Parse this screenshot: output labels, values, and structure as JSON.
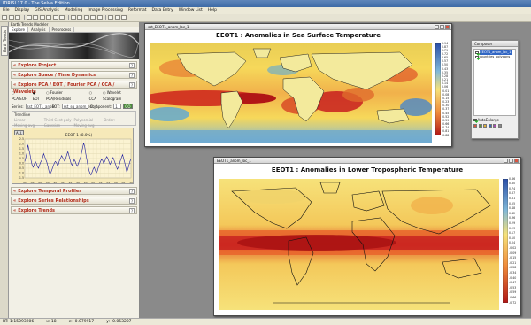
{
  "app": {
    "title": "IDRISI 17.0 · The Selva Edition"
  },
  "menu": [
    "File",
    "Display",
    "GIS Analysis",
    "Modeling",
    "Image Processing",
    "Reformat",
    "Data Entry",
    "Window List",
    "Help"
  ],
  "status": {
    "items": [
      "RT: 1:15093206",
      "x:  18",
      "c:  -0.079917",
      "y:  -0.053207"
    ]
  },
  "side_tab": {
    "label": "Earth Trends Modeler"
  },
  "panel": {
    "title": "Earth Trends Modeler",
    "tabs": [
      "Explore",
      "Analysis",
      "Preprocess"
    ],
    "sections": {
      "project": "Explore Project",
      "space_time": "Explore Space / Time Dynamics",
      "pca": "Explore PCA / EOT / Fourier PCA / CCA / Wavelets",
      "profiles": "Explore Temporal Profiles",
      "relationships": "Explore Series Relationships",
      "trends": "Explore Trends"
    },
    "help_glyph": "?",
    "chevron": "«",
    "pca_options": [
      "PCA/EOF",
      "EOT",
      "Fourier PCA/Residuals",
      "CCA",
      "Wavelet Scalogram"
    ],
    "series_label": "Series:",
    "series_value": "sst_EOT1_anom",
    "eot_label": "EOT:",
    "eot_value": "sst_sg_anom_eot_1",
    "component_label": "Component:",
    "component_value": "1",
    "go_button": "GO",
    "trend_group": "Trendline",
    "trend_options": [
      "Linear",
      "Third-Cent poly",
      "Polynomial",
      "Moving avg",
      "Gaussian moving avg",
      "Moving avg"
    ],
    "order_label": "Order:",
    "chart_toolbar": "ALL",
    "chart_title": "EEOT 1 (8.0%)"
  },
  "chart_data": {
    "type": "line",
    "title": "EEOT 1 (8.0%)",
    "xlabel": "",
    "ylabel": "",
    "x_tick_labels": [
      "82",
      "83",
      "84",
      "85",
      "86",
      "87",
      "88",
      "89",
      "90",
      "91",
      "92",
      "93",
      "94",
      "95",
      "96",
      "97",
      "98",
      "99",
      "00",
      "01",
      "02",
      "03",
      "04",
      "05",
      "06",
      "07",
      "08",
      "09",
      "10"
    ],
    "y_tick_labels": [
      "2.5",
      "2.0",
      "1.5",
      "1.0",
      "0.5",
      "0.0",
      "-0.5",
      "-1.0",
      "-1.5"
    ],
    "ylim": [
      -1.5,
      2.5
    ],
    "grid": true,
    "series": [
      {
        "values": [
          0.2,
          0.6,
          1.1,
          1.9,
          1.4,
          0.9,
          0.3,
          -0.2,
          -0.4,
          -0.1,
          0.2,
          0.0,
          -0.3,
          -0.5,
          -0.2,
          0.1,
          0.3,
          0.6,
          1.0,
          0.7,
          0.4,
          0.1,
          -0.3,
          -0.8,
          -1.1,
          -0.9,
          -0.6,
          -0.3,
          0.0,
          0.2,
          0.1,
          -0.2,
          -0.1,
          0.3,
          0.5,
          0.8,
          0.6,
          0.4,
          0.2,
          0.5,
          0.9,
          1.2,
          0.8,
          0.4,
          0.0,
          -0.2,
          0.1,
          0.4,
          0.2,
          -0.1,
          -0.3,
          0.0,
          0.3,
          0.6,
          1.1,
          1.6,
          2.1,
          1.7,
          1.0,
          0.4,
          -0.2,
          -0.7,
          -1.0,
          -1.2,
          -0.9,
          -0.6,
          -0.4,
          -0.7,
          -1.0,
          -0.8,
          -0.4,
          -0.1,
          0.2,
          0.4,
          0.3,
          0.0,
          0.2,
          0.5,
          0.7,
          0.5,
          0.2,
          -0.1,
          0.1,
          0.4,
          0.6,
          0.3,
          0.0,
          -0.3,
          -0.6,
          -0.4,
          -0.1,
          0.3,
          0.6,
          0.9,
          0.5,
          0.1,
          -0.4,
          -0.9,
          -0.6,
          -0.2,
          0.2,
          0.5
        ]
      }
    ]
  },
  "sst_window": {
    "title": "sst_EEOT1_anom_loc_1",
    "map_title": "EEOT1 : Anomalies in Sea Surface Temperature",
    "legend": [
      "0.94",
      "0.87",
      "0.79",
      "0.72",
      "0.65",
      "0.57",
      "0.50",
      "0.43",
      "0.35",
      "0.28",
      "0.21",
      "0.14",
      "0.06",
      "-0.01",
      "-0.08",
      "-0.15",
      "-0.23",
      "-0.30",
      "-0.37",
      "-0.45",
      "-0.52",
      "-0.59",
      "-0.66",
      "-0.74",
      "-0.81",
      "-0.88"
    ]
  },
  "tlt_window": {
    "title": "EEOT1_anom_loc_1",
    "map_title": "EEOT1 : Anomalies in Lower Tropospheric Temperature",
    "legend": [
      "0.86",
      "0.80",
      "0.74",
      "0.67",
      "0.61",
      "0.55",
      "0.48",
      "0.42",
      "0.36",
      "0.29",
      "0.23",
      "0.17",
      "0.10",
      "0.04",
      "-0.02",
      "-0.09",
      "-0.15",
      "-0.21",
      "-0.28",
      "-0.34",
      "-0.40",
      "-0.47",
      "-0.53",
      "-0.59",
      "-0.66",
      "-0.72"
    ]
  },
  "composer": {
    "title": "Composer",
    "layers": [
      "EEOT1_anom_loc_1",
      "countries_polygons"
    ],
    "auto_enlarge": "AutoEnlarge"
  },
  "colors": {
    "accent_red": "#b22c1a",
    "titlebar": "#3d6aa6",
    "chart_bg": "#f6e9b9",
    "chart_line": "#1a1aa0",
    "map_hot": "#c81e1e",
    "map_warm": "#f6d85a",
    "map_cool": "#5aa6d8",
    "map_cold": "#2a4fa8"
  }
}
